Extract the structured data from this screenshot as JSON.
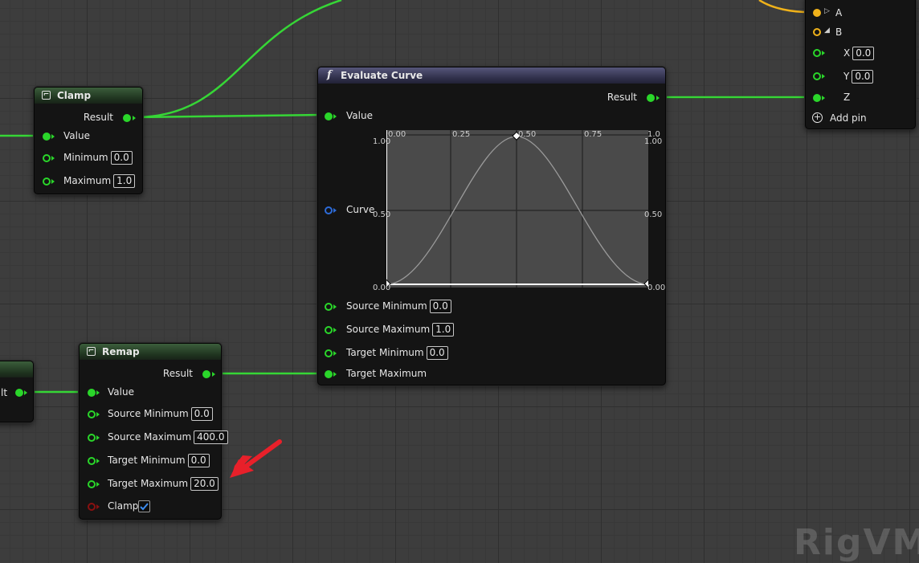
{
  "colors": {
    "exec_green": "#2ad62a",
    "float_pin": "#2ad62a",
    "bool_pin": "#8a1010",
    "curve_pin": "#2d6bd8",
    "vector_pin": "#f0b21a",
    "annotation_arrow": "#e8202a"
  },
  "clamp": {
    "title": "Clamp",
    "icon": "function-icon",
    "result": "Result",
    "value": "Value",
    "minimum": "Minimum",
    "minimum_val": "0.0",
    "maximum": "Maximum",
    "maximum_val": "1.0"
  },
  "evaluate": {
    "title": "Evaluate Curve",
    "icon": "f",
    "result": "Result",
    "value": "Value",
    "curve": "Curve",
    "src_min": "Source Minimum",
    "src_min_val": "0.0",
    "src_max": "Source Maximum",
    "src_max_val": "1.0",
    "tgt_min": "Target Minimum",
    "tgt_min_val": "0.0",
    "tgt_max": "Target Maximum",
    "ticks_top": [
      "0.00",
      "0.25",
      "0.50",
      "0.75",
      "1.0"
    ],
    "tick_y_top": "1.00",
    "tick_y_mid": "0.50",
    "tick_y_bottom": "0.00",
    "tick_y_right_top": "1.00",
    "tick_y_right_mid": "0.50",
    "tick_y_right_bottom": "0.00"
  },
  "remap": {
    "title": "Remap",
    "result": "Result",
    "value": "Value",
    "src_min": "Source Minimum",
    "src_min_val": "0.0",
    "src_max": "Source Maximum",
    "src_max_val": "400.0",
    "tgt_min": "Target Minimum",
    "tgt_min_val": "0.0",
    "tgt_max": "Target Maximum",
    "tgt_max_val": "20.0",
    "clamp": "Clamp",
    "clamp_checked": true
  },
  "vector": {
    "a": "A",
    "b": "B",
    "x": "X",
    "x_val": "0.0",
    "y": "Y",
    "y_val": "0.0",
    "z": "Z",
    "add_pin": "Add pin"
  },
  "left_partial": {
    "label": "lt"
  },
  "watermark": "RigVM"
}
